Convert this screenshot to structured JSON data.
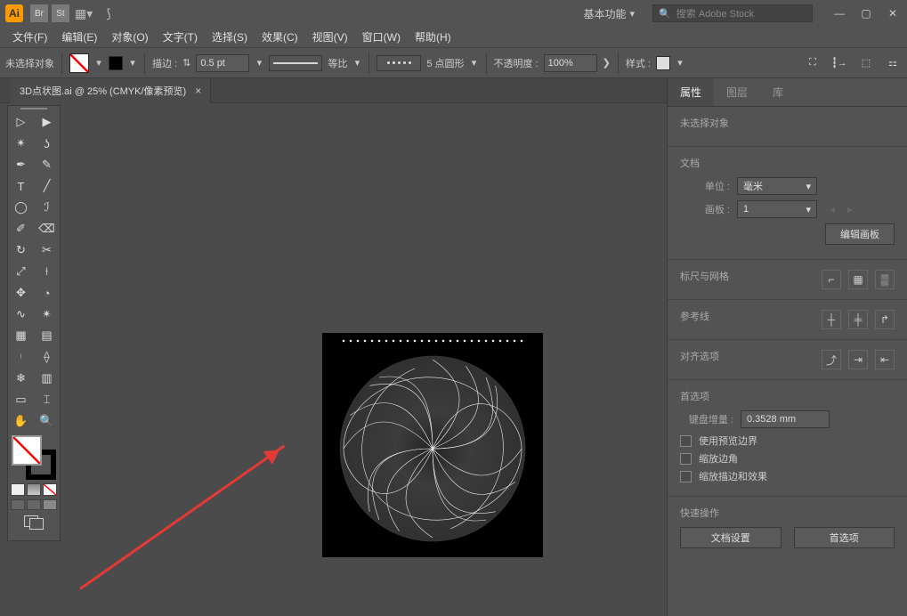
{
  "titlebar": {
    "app_short": "Ai",
    "br": "Br",
    "st": "St",
    "workspace": "基本功能",
    "search_placeholder": "搜索 Adobe Stock"
  },
  "menu": {
    "file": "文件(F)",
    "edit": "编辑(E)",
    "object": "对象(O)",
    "type": "文字(T)",
    "select": "选择(S)",
    "effect": "效果(C)",
    "view": "视图(V)",
    "window": "窗口(W)",
    "help": "帮助(H)"
  },
  "control": {
    "noselection": "未选择对象",
    "stroke": "描边 :",
    "stroke_weight": "0.5 pt",
    "uniform": "等比",
    "dash": "5 点圆形",
    "opacity": "不透明度 :",
    "opacity_val": "100%",
    "style": "样式 :"
  },
  "document": {
    "tab": "3D点状图.ai @ 25% (CMYK/像素预览)"
  },
  "panel": {
    "tabs": {
      "properties": "属性",
      "layers": "图层",
      "libraries": "库"
    },
    "noselection": "未选择对象",
    "docsec": "文档",
    "units_label": "单位 :",
    "units_value": "毫米",
    "artboard_label": "画板 :",
    "artboard_value": "1",
    "edit_artboard": "编辑画板",
    "rulers": "标尺与网格",
    "guides": "参考线",
    "align": "对齐选项",
    "prefs": "首选项",
    "keyincr_label": "键盘增量 :",
    "keyincr_value": "0.3528 mm",
    "chk_preview": "使用预览边界",
    "chk_scale_corner": "缩放边角",
    "chk_scale_stroke": "缩放描边和效果",
    "quick": "快速操作",
    "doc_setup": "文档设置",
    "pref_btn": "首选项"
  }
}
